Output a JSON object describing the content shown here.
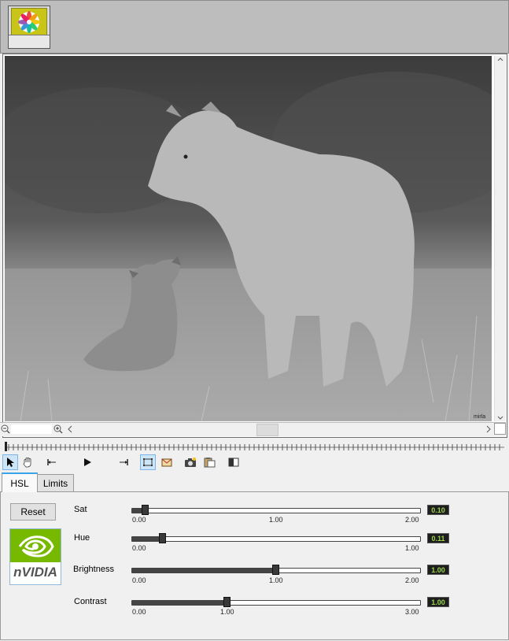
{
  "app": {
    "preview_thumb_icon": "photo-app-icon"
  },
  "zoom": {
    "out_icon": "zoom-out-icon",
    "in_icon": "zoom-in-icon"
  },
  "toolbar": {
    "icons": [
      "arrow-pointer-icon",
      "hand-pan-icon",
      "jump-start-icon",
      "play-icon",
      "jump-end-icon",
      "crop-select-icon",
      "image-icon",
      "camera-icon",
      "clipboard-icon",
      "split-view-icon"
    ]
  },
  "tabs": {
    "hsl": "HSL",
    "limits": "Limits"
  },
  "panel": {
    "reset_label": "Reset",
    "logo_text": "nVIDIA",
    "rows": [
      {
        "label": "Sat",
        "min": "0.00",
        "mid": "1.00",
        "max": "2.00",
        "value": "0.10"
      },
      {
        "label": "Hue",
        "min": "0.00",
        "max": "1.00",
        "value": "0.11"
      },
      {
        "label": "Brightness",
        "min": "0.00",
        "mid": "1.00",
        "max": "2.00",
        "value": "1.00"
      },
      {
        "label": "Contrast",
        "min": "0.00",
        "mid": "1.00",
        "max": "3.00",
        "value": "1.00"
      }
    ]
  },
  "image": {
    "watermark": "mirla"
  },
  "colors": {
    "tab_accent": "#39a5e8",
    "value_text": "#9bd44a"
  }
}
